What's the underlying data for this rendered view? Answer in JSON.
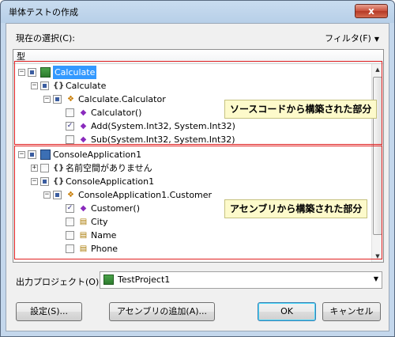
{
  "window": {
    "title": "単体テストの作成",
    "close_label": "x"
  },
  "current_selection_label": "現在の選択(C):",
  "filter_label": "フィルタ(F)",
  "tree": {
    "header": "型",
    "rows": [
      {
        "text": "Calculate"
      },
      {
        "text": "Calculate"
      },
      {
        "text": "Calculate.Calculator"
      },
      {
        "text": "Calculator()"
      },
      {
        "text": "Add(System.Int32, System.Int32)"
      },
      {
        "text": "Sub(System.Int32, System.Int32)"
      },
      {
        "text": "ConsoleApplication1"
      },
      {
        "text": "名前空間がありません"
      },
      {
        "text": "ConsoleApplication1"
      },
      {
        "text": "ConsoleApplication1.Customer"
      },
      {
        "text": "Customer()"
      },
      {
        "text": "City"
      },
      {
        "text": "Name"
      },
      {
        "text": "Phone"
      }
    ],
    "ns_glyph": "{}"
  },
  "callouts": {
    "source": "ソースコードから構築された部分",
    "assembly": "アセンブリから構築された部分"
  },
  "output": {
    "label": "出力プロジェクト(O):",
    "value": "TestProject1"
  },
  "buttons": {
    "settings": "設定(S)...",
    "add_assembly": "アセンブリの追加(A)...",
    "ok": "OK",
    "cancel": "キャンセル"
  },
  "colors": {
    "selection": "#3399ff",
    "annotation": "#e02020",
    "callout_bg": "#fdfacb"
  }
}
